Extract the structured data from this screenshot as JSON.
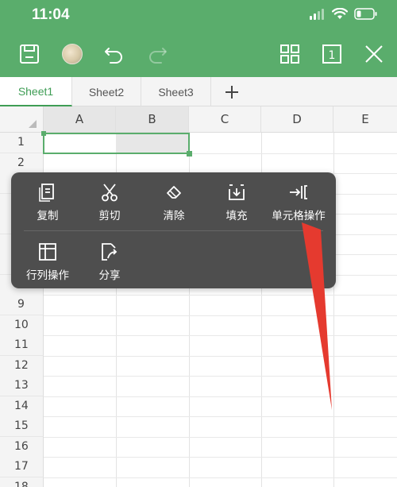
{
  "status_bar": {
    "time": "11:04"
  },
  "toolbar": {
    "icons": [
      "save-icon",
      "avatar",
      "undo-icon",
      "redo-icon",
      "grid-view-icon",
      "sheet-count-icon",
      "close-icon"
    ],
    "sheet_count": "1"
  },
  "tabs": {
    "items": [
      {
        "label": "Sheet1",
        "active": true
      },
      {
        "label": "Sheet2",
        "active": false
      },
      {
        "label": "Sheet3",
        "active": false
      }
    ],
    "add_label": "+"
  },
  "grid": {
    "columns": [
      "A",
      "B",
      "C",
      "D",
      "E"
    ],
    "rows": [
      "1",
      "2",
      "9",
      "10",
      "11",
      "12",
      "13",
      "14",
      "15",
      "16",
      "17",
      "18"
    ],
    "selected_range": "A1:B1"
  },
  "context_menu": {
    "row1": [
      {
        "label": "复制",
        "icon": "copy-icon"
      },
      {
        "label": "剪切",
        "icon": "scissors-icon"
      },
      {
        "label": "清除",
        "icon": "eraser-icon"
      },
      {
        "label": "填充",
        "icon": "fill-icon"
      },
      {
        "label": "单元格操作",
        "icon": "cell-operation-icon"
      }
    ],
    "row2": [
      {
        "label": "行列操作",
        "icon": "row-column-icon"
      },
      {
        "label": "分享",
        "icon": "share-icon"
      }
    ]
  },
  "colors": {
    "brand_green": "#5aad6c",
    "menu_bg": "#4e4e4e",
    "annotation_arrow": "#e53a2f"
  }
}
